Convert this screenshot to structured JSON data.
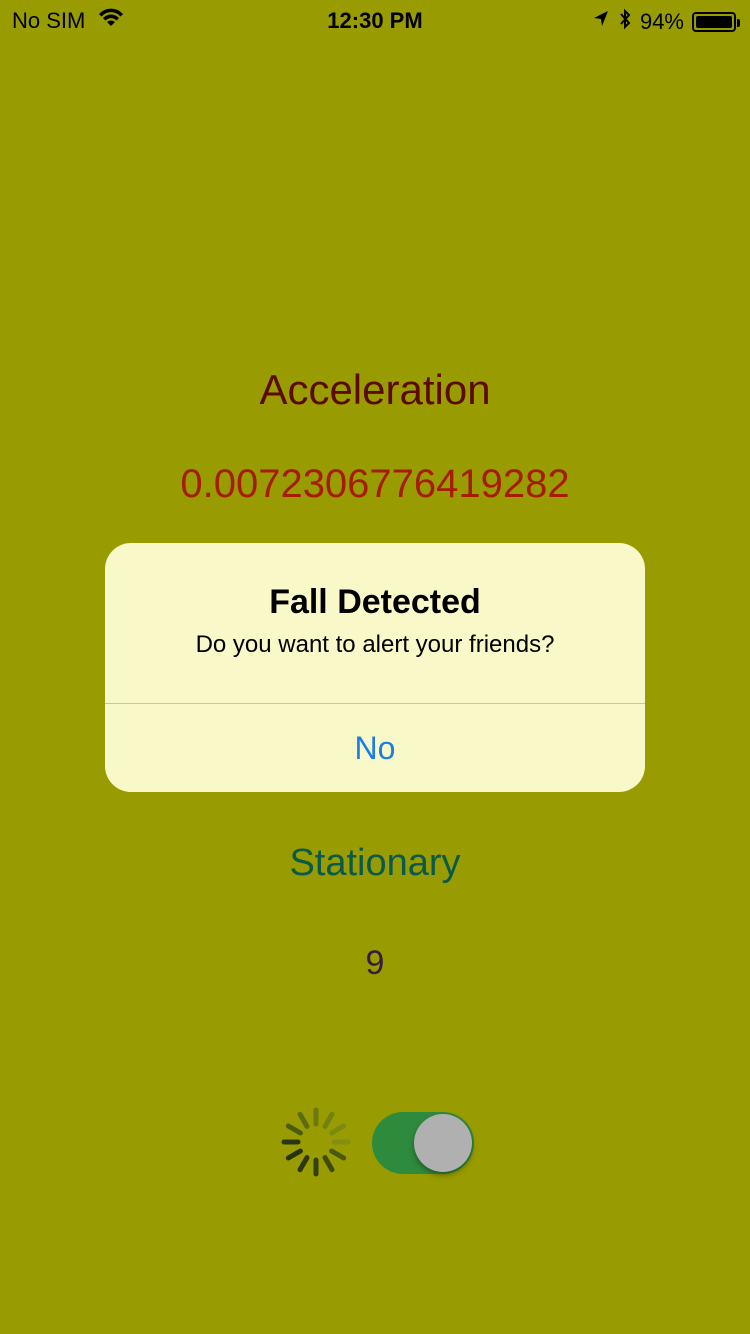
{
  "status_bar": {
    "carrier": "No SIM",
    "time": "12:30 PM",
    "battery_percent": "94%",
    "icons": [
      "wifi-icon",
      "location-arrow-icon",
      "bluetooth-icon",
      "battery-icon"
    ]
  },
  "main": {
    "acceleration_title": "Acceleration",
    "acceleration_value": "0.0072306776419282",
    "state_label": "Stationary",
    "count_value": "9"
  },
  "alert": {
    "title": "Fall Detected",
    "message": "Do you want to alert your friends?",
    "button_label": "No"
  },
  "controls": {
    "spinner_icon": "activity-spinner-icon",
    "toggle_on": true
  },
  "colors": {
    "background": "#989c00",
    "alert_background": "#f8f8c8",
    "alert_button": "#1a7ee6",
    "toggle_on": "#2e8b3e"
  }
}
